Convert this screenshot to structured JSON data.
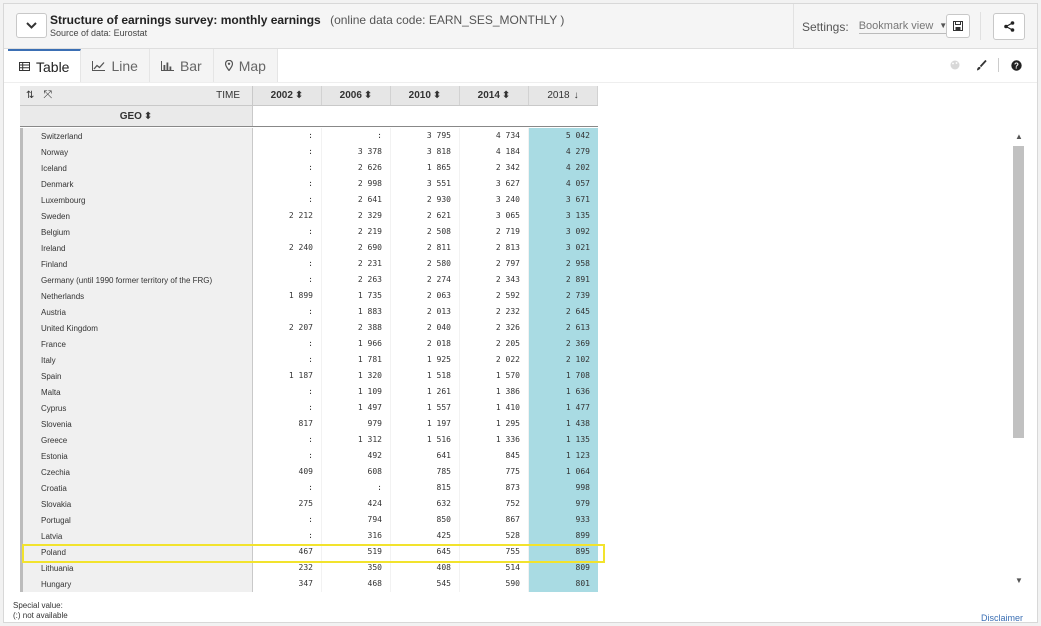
{
  "header": {
    "title": "Structure of earnings survey: monthly earnings",
    "code": "(online data code: EARN_SES_MONTHLY )",
    "source_label": "Source of data:",
    "source_value": "Eurostat",
    "settings_label": "Settings:",
    "bookmark_value": "Bookmark view"
  },
  "tabs": [
    {
      "label": "Table",
      "icon": "table-icon",
      "active": true
    },
    {
      "label": "Line",
      "icon": "line-chart-icon",
      "active": false
    },
    {
      "label": "Bar",
      "icon": "bar-chart-icon",
      "active": false
    },
    {
      "label": "Map",
      "icon": "map-marker-icon",
      "active": false
    }
  ],
  "table": {
    "time_label": "TIME",
    "geo_label": "GEO",
    "years": [
      "2002",
      "2006",
      "2010",
      "2014",
      "2018"
    ],
    "rows": [
      {
        "geo": "Switzerland",
        "v": [
          ":",
          ":",
          "3 795",
          "4 734",
          "5 042"
        ]
      },
      {
        "geo": "Norway",
        "v": [
          ":",
          "3 378",
          "3 818",
          "4 184",
          "4 279"
        ]
      },
      {
        "geo": "Iceland",
        "v": [
          ":",
          "2 626",
          "1 865",
          "2 342",
          "4 202"
        ]
      },
      {
        "geo": "Denmark",
        "v": [
          ":",
          "2 998",
          "3 551",
          "3 627",
          "4 057"
        ]
      },
      {
        "geo": "Luxembourg",
        "v": [
          ":",
          "2 641",
          "2 930",
          "3 240",
          "3 671"
        ]
      },
      {
        "geo": "Sweden",
        "v": [
          "2 212",
          "2 329",
          "2 621",
          "3 065",
          "3 135"
        ]
      },
      {
        "geo": "Belgium",
        "v": [
          ":",
          "2 219",
          "2 508",
          "2 719",
          "3 092"
        ]
      },
      {
        "geo": "Ireland",
        "v": [
          "2 240",
          "2 690",
          "2 811",
          "2 813",
          "3 021"
        ]
      },
      {
        "geo": "Finland",
        "v": [
          ":",
          "2 231",
          "2 580",
          "2 797",
          "2 958"
        ]
      },
      {
        "geo": "Germany (until 1990 former territory of the FRG)",
        "v": [
          ":",
          "2 263",
          "2 274",
          "2 343",
          "2 891"
        ]
      },
      {
        "geo": "Netherlands",
        "v": [
          "1 899",
          "1 735",
          "2 063",
          "2 592",
          "2 739"
        ]
      },
      {
        "geo": "Austria",
        "v": [
          ":",
          "1 883",
          "2 013",
          "2 232",
          "2 645"
        ]
      },
      {
        "geo": "United Kingdom",
        "v": [
          "2 207",
          "2 388",
          "2 040",
          "2 326",
          "2 613"
        ]
      },
      {
        "geo": "France",
        "v": [
          ":",
          "1 966",
          "2 018",
          "2 205",
          "2 369"
        ]
      },
      {
        "geo": "Italy",
        "v": [
          ":",
          "1 781",
          "1 925",
          "2 022",
          "2 102"
        ]
      },
      {
        "geo": "Spain",
        "v": [
          "1 187",
          "1 320",
          "1 518",
          "1 570",
          "1 708"
        ]
      },
      {
        "geo": "Malta",
        "v": [
          ":",
          "1 109",
          "1 261",
          "1 386",
          "1 636"
        ]
      },
      {
        "geo": "Cyprus",
        "v": [
          ":",
          "1 497",
          "1 557",
          "1 410",
          "1 477"
        ]
      },
      {
        "geo": "Slovenia",
        "v": [
          "817",
          "979",
          "1 197",
          "1 295",
          "1 438"
        ]
      },
      {
        "geo": "Greece",
        "v": [
          ":",
          "1 312",
          "1 516",
          "1 336",
          "1 135"
        ]
      },
      {
        "geo": "Estonia",
        "v": [
          ":",
          "492",
          "641",
          "845",
          "1 123"
        ]
      },
      {
        "geo": "Czechia",
        "v": [
          "409",
          "608",
          "785",
          "775",
          "1 064"
        ]
      },
      {
        "geo": "Croatia",
        "v": [
          ":",
          ":",
          "815",
          "873",
          "998"
        ]
      },
      {
        "geo": "Slovakia",
        "v": [
          "275",
          "424",
          "632",
          "752",
          "979"
        ]
      },
      {
        "geo": "Portugal",
        "v": [
          ":",
          "794",
          "850",
          "867",
          "933"
        ]
      },
      {
        "geo": "Latvia",
        "v": [
          ":",
          "316",
          "425",
          "528",
          "899"
        ]
      },
      {
        "geo": "Poland",
        "v": [
          "467",
          "519",
          "645",
          "755",
          "895"
        ]
      },
      {
        "geo": "Lithuania",
        "v": [
          "232",
          "350",
          "408",
          "514",
          "809"
        ]
      },
      {
        "geo": "Hungary",
        "v": [
          "347",
          "468",
          "545",
          "590",
          "801"
        ]
      }
    ]
  },
  "footer": {
    "special_value_label": "Special value:",
    "not_available": "(:) not available",
    "disclaimer": "Disclaimer"
  },
  "colors": {
    "sorted_column": "#a9dbe3",
    "highlight": "#f2e32d",
    "accent": "#3b6fb4"
  }
}
